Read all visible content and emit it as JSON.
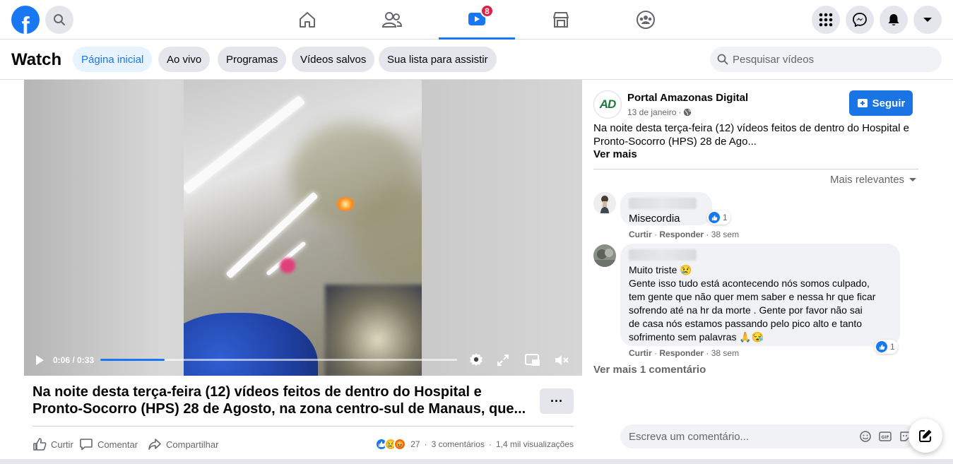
{
  "header": {
    "logo_letter": "f",
    "watch_badge": "8",
    "icons": [
      "facebook-logo",
      "search-icon",
      "home-icon",
      "friends-icon",
      "watch-icon",
      "marketplace-icon",
      "groups-icon",
      "menu-grid-icon",
      "messenger-icon",
      "notifications-icon",
      "account-dropdown-icon"
    ]
  },
  "watch": {
    "title": "Watch",
    "tabs": [
      {
        "label": "Página inicial",
        "active": true
      },
      {
        "label": "Ao vivo",
        "active": false
      },
      {
        "label": "Programas",
        "active": false
      },
      {
        "label": "Vídeos salvos",
        "active": false
      },
      {
        "label": "Sua lista para assistir",
        "active": false
      }
    ],
    "search_placeholder": "Pesquisar vídeos"
  },
  "video": {
    "current_time": "0:06",
    "duration": "0:33",
    "time_display": "0:06 / 0:33",
    "progress_fraction": 0.18,
    "title": "Na noite desta terça-feira (12) vídeos feitos de dentro do Hospital e Pronto-Socorro (HPS) 28 de Agosto, na zona centro-sul de Manaus, que...",
    "more_label": "···",
    "actions": {
      "like": "Curtir",
      "comment": "Comentar",
      "share": "Compartilhar"
    },
    "stats": {
      "reactions_count": "27",
      "comments": "3 comentários",
      "separator": "·",
      "views": "1,4 mil visualizações"
    }
  },
  "post": {
    "page_name": "Portal Amazonas Digital",
    "avatar_initials": "AD",
    "date": "13 de janeiro",
    "date_separator": "·",
    "follow_label": "Seguir",
    "description": "Na noite desta terça-feira (12) vídeos feitos de dentro do Hospital e Pronto-Socorro (HPS) 28 de Ago...",
    "see_more": "Ver mais",
    "sort_label": "Mais relevantes"
  },
  "comments": [
    {
      "text": "Misecordia",
      "likes": "1",
      "like_label": "Curtir",
      "reply_label": "Responder",
      "time": "38 sem",
      "separator": "·"
    },
    {
      "text": "Muito triste 😢\nGente isso tudo está acontecendo nós somos culpado,\ntem gente que não quer mem saber e nessa hr que ficar\nsofrendo até na hr da morte . Gente por favor não sai\nde casa nós estamos passando pelo pico alto e tanto\nsofrimento sem palavras 🙏😪",
      "likes": "1",
      "like_label": "Curtir",
      "reply_label": "Responder",
      "time": "38 sem",
      "separator": "·"
    }
  ],
  "view_more_comments": "Ver mais 1 comentário",
  "comment_input_placeholder": "Escreva um comentário...",
  "colors": {
    "brand": "#1877f2",
    "badge": "#e41e3f",
    "follow": "#1b74e4"
  }
}
